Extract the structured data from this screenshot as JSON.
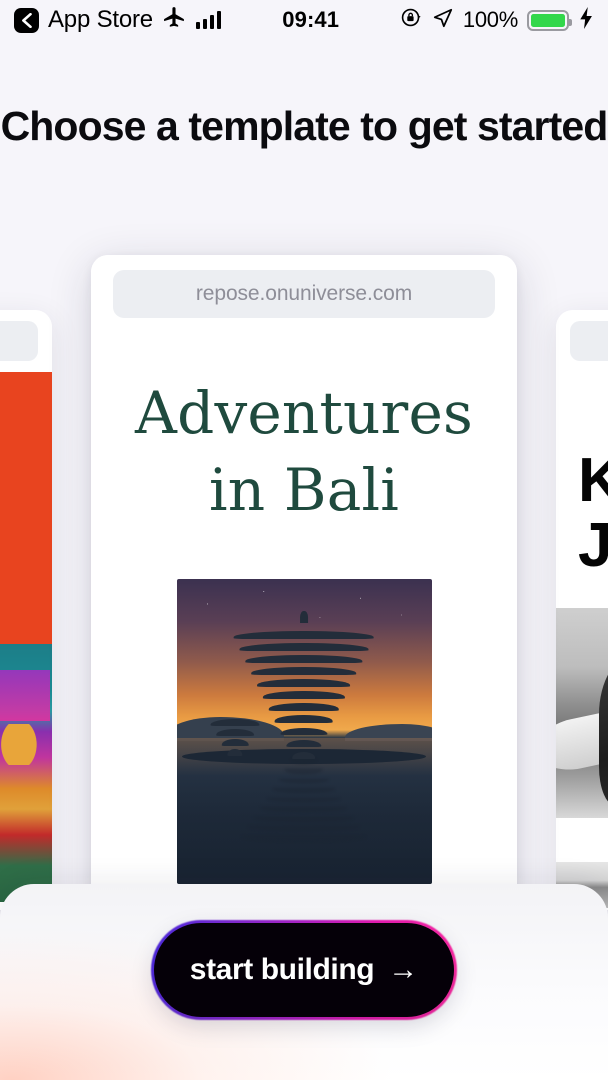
{
  "status_bar": {
    "back_label": "App Store",
    "back_icon": "chevron-left-icon",
    "airplane_icon": "airplane-mode-icon",
    "signal_icon": "cellular-signal-icon",
    "time": "09:41",
    "rotation_lock_icon": "rotation-lock-icon",
    "location_icon": "location-arrow-icon",
    "battery_percent": "100%",
    "battery_icon": "battery-full-icon",
    "charging_icon": "charging-bolt-icon",
    "battery_color": "#32d74b"
  },
  "header": {
    "title": "Choose a template to get started"
  },
  "carousel": {
    "center_card": {
      "url": "repose.onuniverse.com",
      "site_title": "Adventures\nin Bali",
      "title_color": "#1f4a3e",
      "hero_image_alt": "balinese-lake-temple-at-sunset"
    },
    "left_card": {
      "accent_color": "#e8441f",
      "photo_alt": "street-food-market-storefront"
    },
    "right_card": {
      "title": "K\nJ",
      "title_color": "#050505",
      "photo_alt": "black-and-white-surfer-with-surfboard"
    }
  },
  "bottom_sheet": {
    "cta_label": "start building",
    "cta_arrow": "→",
    "cta_background": "#050008",
    "cta_border_gradient": "#4b2ae0 → #ff2ba0"
  }
}
